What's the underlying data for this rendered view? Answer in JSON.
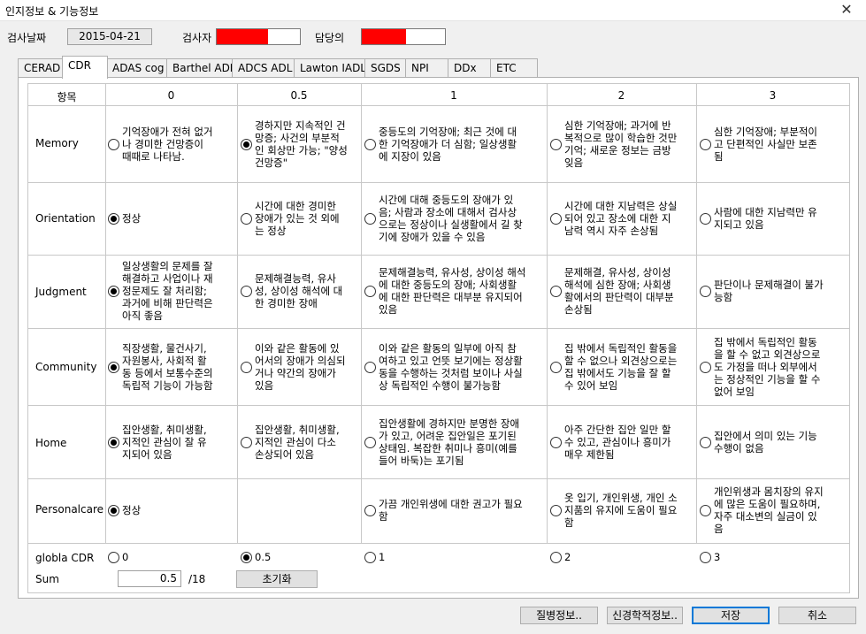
{
  "window": {
    "title": "인지정보 & 기능정보",
    "close_glyph": "✕"
  },
  "info": {
    "date_label": "검사날짜",
    "date_value": "2015-04-21",
    "examiner_label": "검사자",
    "manager_label": "담당의",
    "redacted_color": "#ff0000"
  },
  "tabs": [
    {
      "label": "CERAD"
    },
    {
      "label": "CDR",
      "active": true
    },
    {
      "label": "ADAS cog"
    },
    {
      "label": "Barthel ADL"
    },
    {
      "label": "ADCS ADL"
    },
    {
      "label": "Lawton IADL"
    },
    {
      "label": "SGDS"
    },
    {
      "label": "NPI"
    },
    {
      "label": "DDx"
    },
    {
      "label": "ETC"
    }
  ],
  "table": {
    "headers": [
      "항목",
      "0",
      "0.5",
      "1",
      "2",
      "3"
    ],
    "rows": [
      {
        "label": "Memory",
        "selected": 1,
        "options": [
          "기억장애가 전혀 없거\n나 경미한 건망증이\n때때로 나타남.",
          "경하지만 지속적인 건\n망증; 사건의 부분적\n인 회상만 가능; \"양성\n건망증\"",
          "중등도의 기억장애; 최근 것에 대\n한 기억장애가 더 심함; 일상생활\n에 지장이 있음",
          "심한 기억장애; 과거에 반\n복적으로 많이 학습한 것만\n기억; 새로운 정보는 금방\n잊음",
          "심한 기억장애; 부분적이\n고 단편적인 사실만 보존\n됨"
        ]
      },
      {
        "label": "Orientation",
        "selected": 0,
        "options": [
          "정상",
          "시간에 대한 경미한\n장애가 있는 것 외에\n는 정상",
          "시간에 대해 중등도의 장애가 있\n음; 사람과 장소에 대해서 검사상\n으로는 정상이나 실생활에서 길 찾\n기에 장애가 있을 수 있음",
          "시간에 대한 지남력은 상실\n되어 있고 장소에 대한 지\n남력 역시 자주 손상됨",
          "사람에 대한 지남력만 유\n지되고 있음"
        ]
      },
      {
        "label": "Judgment",
        "selected": 0,
        "options": [
          "일상생활의 문제를 잘\n해결하고 사업이나 재\n정문제도 잘 처리함;\n과거에 비해 판단력은\n아직 좋음",
          "문제해결능력, 유사\n성, 상이성 해석에 대\n한 경미한 장애",
          "문제해결능력, 유사성, 상이성 해석\n에 대한 중등도의 장애; 사회생활\n에 대한 판단력은 대부분 유지되어\n있음",
          "문제해결, 유사성, 상이성\n해석에 심한 장애; 사회생\n활에서의 판단력이 대부분\n손상됨",
          "판단이나 문제해결이 불가\n능함"
        ]
      },
      {
        "label": "Community",
        "selected": 0,
        "options": [
          "직장생활, 물건사기,\n자원봉사, 사회적 활\n동 등에서 보통수준의\n독립적 기능이 가능함",
          "이와 같은 활동에 있\n어서의 장애가 의심되\n거나 약간의 장애가\n있음",
          "이와 같은 활동의 일부에 아직 참\n여하고 있고 언뜻 보기에는 정상활\n동을 수행하는 것처럼 보이나 사실\n상 독립적인 수행이 불가능함",
          "집 밖에서 독립적인 활동을\n할 수 없으나 외견상으로는\n집 밖에서도 기능을 잘 할\n수 있어 보임",
          "집 밖에서 독립적인 활동\n을 할 수 없고 외견상으로\n도 가정을 떠나 외부에서\n는 정상적인 기능을 할 수\n없어 보임"
        ]
      },
      {
        "label": "Home",
        "selected": 0,
        "options": [
          "집안생활, 취미생활,\n지적인 관심이 잘 유\n지되어 있음",
          "집안생활, 취미생활,\n지적인 관심이 다소\n손상되어 있음",
          "집안생활에 경하지만 분명한 장애\n가 있고, 어려운 집안일은 포기된\n상태임. 복잡한 취미나 흥미(예를\n들어 바둑)는 포기됨",
          "아주 간단한 집안 일만 할\n수 있고, 관심이나 흥미가\n매우 제한됨",
          "집안에서 의미 있는 기능\n수행이 없음"
        ]
      },
      {
        "label": "Personalcare",
        "selected": 0,
        "options": [
          "정상",
          "",
          "가끔 개인위생에 대한 권고가 필요\n함",
          "옷 입기, 개인위생, 개인 소\n지품의 유지에 도움이 필요\n함",
          "개인위생과 몸치장의 유지\n에 많은 도움이 필요하며,\n자주 대소변의 실금이 있\n음"
        ]
      }
    ],
    "global": {
      "label": "globla CDR",
      "selected": 1,
      "options": [
        "0",
        "0.5",
        "1",
        "2",
        "3"
      ]
    },
    "sum": {
      "label": "Sum",
      "value": "0.5",
      "max": "/18",
      "reset_label": "초기화"
    }
  },
  "footer": {
    "disease_info": "질병정보..",
    "neuro_info": "신경학적정보..",
    "save": "저장",
    "cancel": "취소"
  }
}
